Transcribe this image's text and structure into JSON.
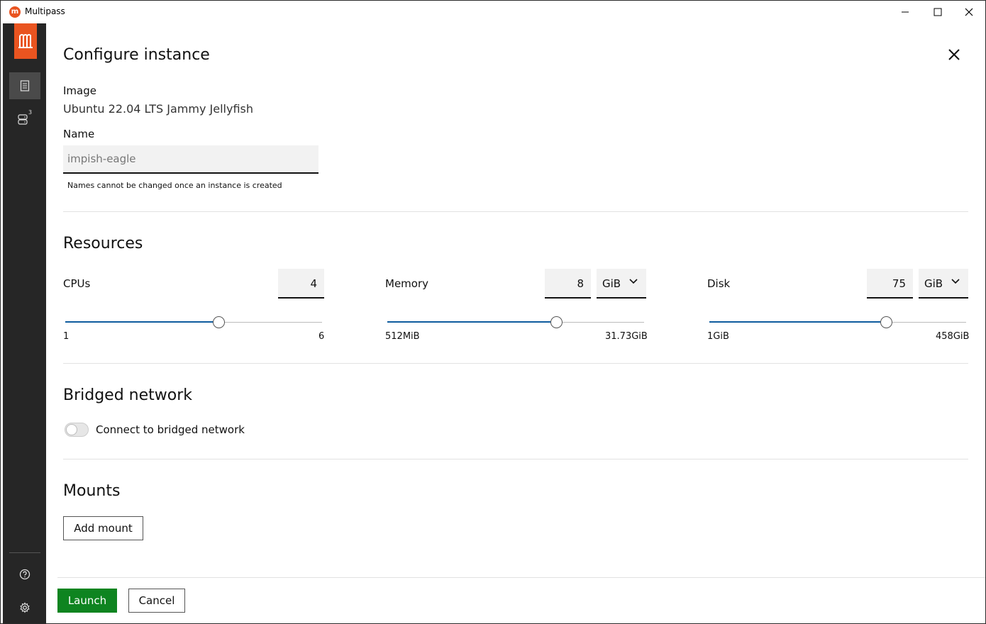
{
  "window": {
    "title": "Multipass",
    "app_icon_glyph": "m"
  },
  "sidebar": {
    "logo_glyph": "m",
    "items": [
      {
        "name": "catalogue",
        "icon": "catalogue-icon",
        "active": true
      },
      {
        "name": "instances",
        "icon": "instances-icon",
        "badge": "3"
      }
    ],
    "bottom": [
      {
        "name": "help",
        "icon": "help-icon"
      },
      {
        "name": "settings",
        "icon": "gear-icon"
      }
    ]
  },
  "page": {
    "title": "Configure instance"
  },
  "image": {
    "label": "Image",
    "value": "Ubuntu 22.04 LTS Jammy Jellyfish"
  },
  "name": {
    "label": "Name",
    "value": "impish-eagle",
    "hint": "Names cannot be changed once an instance is created"
  },
  "resources": {
    "title": "Resources",
    "cpus": {
      "label": "CPUs",
      "value": "4",
      "min": "1",
      "max": "6",
      "fraction": 0.6
    },
    "memory": {
      "label": "Memory",
      "value": "8",
      "unit": "GiB",
      "min": "512MiB",
      "max": "31.73GiB",
      "fraction": 0.66
    },
    "disk": {
      "label": "Disk",
      "value": "75",
      "unit": "GiB",
      "min": "1GiB",
      "max": "458GiB",
      "fraction": 0.69
    }
  },
  "bridged": {
    "title": "Bridged network",
    "toggle_label": "Connect to bridged network",
    "enabled": false
  },
  "mounts": {
    "title": "Mounts",
    "add_label": "Add mount"
  },
  "footer": {
    "launch_label": "Launch",
    "cancel_label": "Cancel"
  },
  "colors": {
    "brand": "#e95420",
    "primary": "#0e8420",
    "slider": "#0e5c9e",
    "sidebar": "#262626"
  }
}
